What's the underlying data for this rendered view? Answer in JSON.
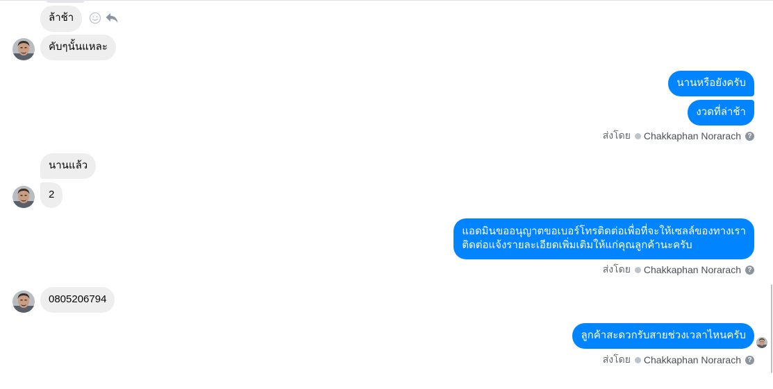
{
  "conversation": {
    "messages": [
      {
        "id": "m1",
        "direction": "in",
        "text": "ล้าช้า"
      },
      {
        "id": "m2",
        "direction": "in",
        "text": "คับๆนั้นแหละ"
      },
      {
        "id": "m3",
        "direction": "out",
        "text": "นานหรือยังครับ"
      },
      {
        "id": "m4",
        "direction": "out",
        "text": "งวดที่ล่าช้า"
      },
      {
        "id": "m5",
        "direction": "in",
        "text": "นานแล้ว"
      },
      {
        "id": "m6",
        "direction": "in",
        "text": "2"
      },
      {
        "id": "m7",
        "direction": "out",
        "line1": "แอดมินขออนุญาตขอเบอร์โทรติดต่อเพื่อที่จะให้เซลล์ของทางเรา",
        "line2": "ติดต่อแจ้งรายละเอียดเพิ่มเติมให้แก่คุณลูกค้านะครับ"
      },
      {
        "id": "m8",
        "direction": "in",
        "text": "0805206794"
      },
      {
        "id": "m9",
        "direction": "out",
        "text": "ลูกค้าสะดวกรับสายช่วงเวลาไหนครับ"
      }
    ],
    "sent_by": {
      "prefix": "ส่งโดย",
      "sender_name": "Chakkaphan Norarach",
      "help_glyph": "?"
    }
  },
  "icons": {
    "reaction": "smiley-icon",
    "reply": "reply-arrow-icon",
    "avatar": "contact-avatar",
    "seen": "seen-avatar-icon"
  },
  "colors": {
    "outgoing_bubble": "#0084ff",
    "incoming_bubble": "#eeeeee",
    "meta_text": "#606770",
    "icon_gray": "#8d949e"
  }
}
